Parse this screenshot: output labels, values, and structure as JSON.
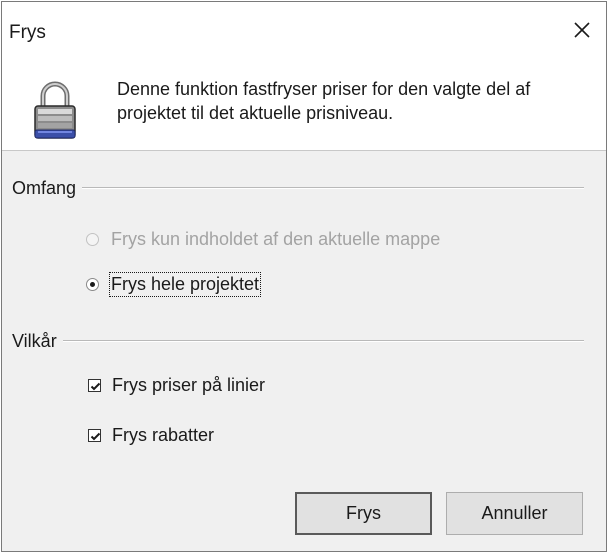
{
  "window": {
    "title": "Frys"
  },
  "header": {
    "description": "Denne funktion fastfryser priser for den valgte del af projektet til det aktuelle prisniveau.",
    "icon": "lock-icon"
  },
  "scope_group": {
    "label": "Omfang",
    "options": [
      {
        "label": "Frys kun indholdet af den aktuelle mappe",
        "selected": false,
        "enabled": false
      },
      {
        "label": "Frys hele projektet",
        "selected": true,
        "enabled": true
      }
    ]
  },
  "conditions_group": {
    "label": "Vilkår",
    "options": [
      {
        "label": "Frys priser på linier",
        "checked": true
      },
      {
        "label": "Frys rabatter",
        "checked": true
      }
    ]
  },
  "buttons": {
    "ok_label": "Frys",
    "cancel_label": "Annuller"
  },
  "colors": {
    "dialog_bg": "#f0f0f0",
    "header_bg": "#ffffff",
    "disabled_text": "#a3a3a3"
  }
}
